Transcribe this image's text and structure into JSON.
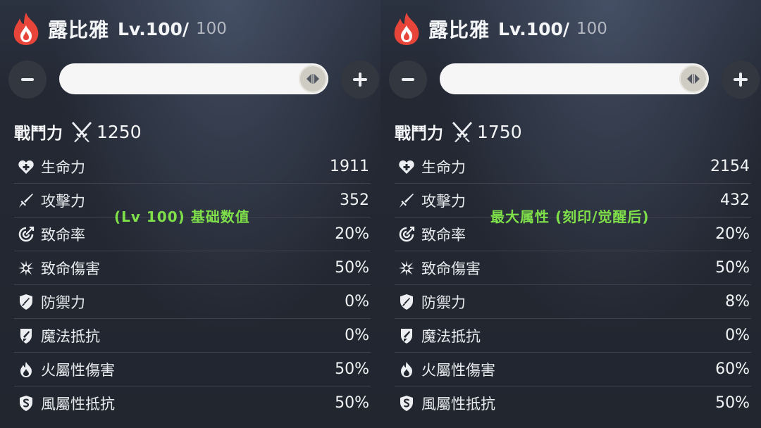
{
  "left": {
    "name": "露比雅",
    "level": "Lv.100/",
    "level_max": "100",
    "slider_fraction": 1.0,
    "power_label": "戰鬥力",
    "power_value": "1250",
    "note": "(Lv 100) 基础数值",
    "stats": [
      {
        "icon": "heart-plus-icon",
        "label": "生命力",
        "value": "1911"
      },
      {
        "icon": "sword-icon",
        "label": "攻擊力",
        "value": "352"
      },
      {
        "icon": "crit-target-icon",
        "label": "致命率",
        "value": "20%"
      },
      {
        "icon": "burst-icon",
        "label": "致命傷害",
        "value": "50%"
      },
      {
        "icon": "shield-sword-icon",
        "label": "防禦力",
        "value": "0%"
      },
      {
        "icon": "magic-shield-icon",
        "label": "魔法抵抗",
        "value": "0%"
      },
      {
        "icon": "fire-icon",
        "label": "火屬性傷害",
        "value": "50%"
      },
      {
        "icon": "wind-shield-icon",
        "label": "風屬性抵抗",
        "value": "50%"
      }
    ]
  },
  "right": {
    "name": "露比雅",
    "level": "Lv.100/",
    "level_max": "100",
    "slider_fraction": 1.0,
    "power_label": "戰鬥力",
    "power_value": "1750",
    "note": "最大属性 (刻印/觉醒后)",
    "stats": [
      {
        "icon": "heart-plus-icon",
        "label": "生命力",
        "value": "2154"
      },
      {
        "icon": "sword-icon",
        "label": "攻擊力",
        "value": "432"
      },
      {
        "icon": "crit-target-icon",
        "label": "致命率",
        "value": "20%"
      },
      {
        "icon": "burst-icon",
        "label": "致命傷害",
        "value": "50%"
      },
      {
        "icon": "shield-sword-icon",
        "label": "防禦力",
        "value": "8%"
      },
      {
        "icon": "magic-shield-icon",
        "label": "魔法抵抗",
        "value": "0%"
      },
      {
        "icon": "fire-icon",
        "label": "火屬性傷害",
        "value": "60%"
      },
      {
        "icon": "wind-shield-icon",
        "label": "風屬性抵抗",
        "value": "50%"
      }
    ]
  },
  "colors": {
    "fire_accent": "#e8453a",
    "note_green": "#7fe04a",
    "background": "#22262f"
  }
}
